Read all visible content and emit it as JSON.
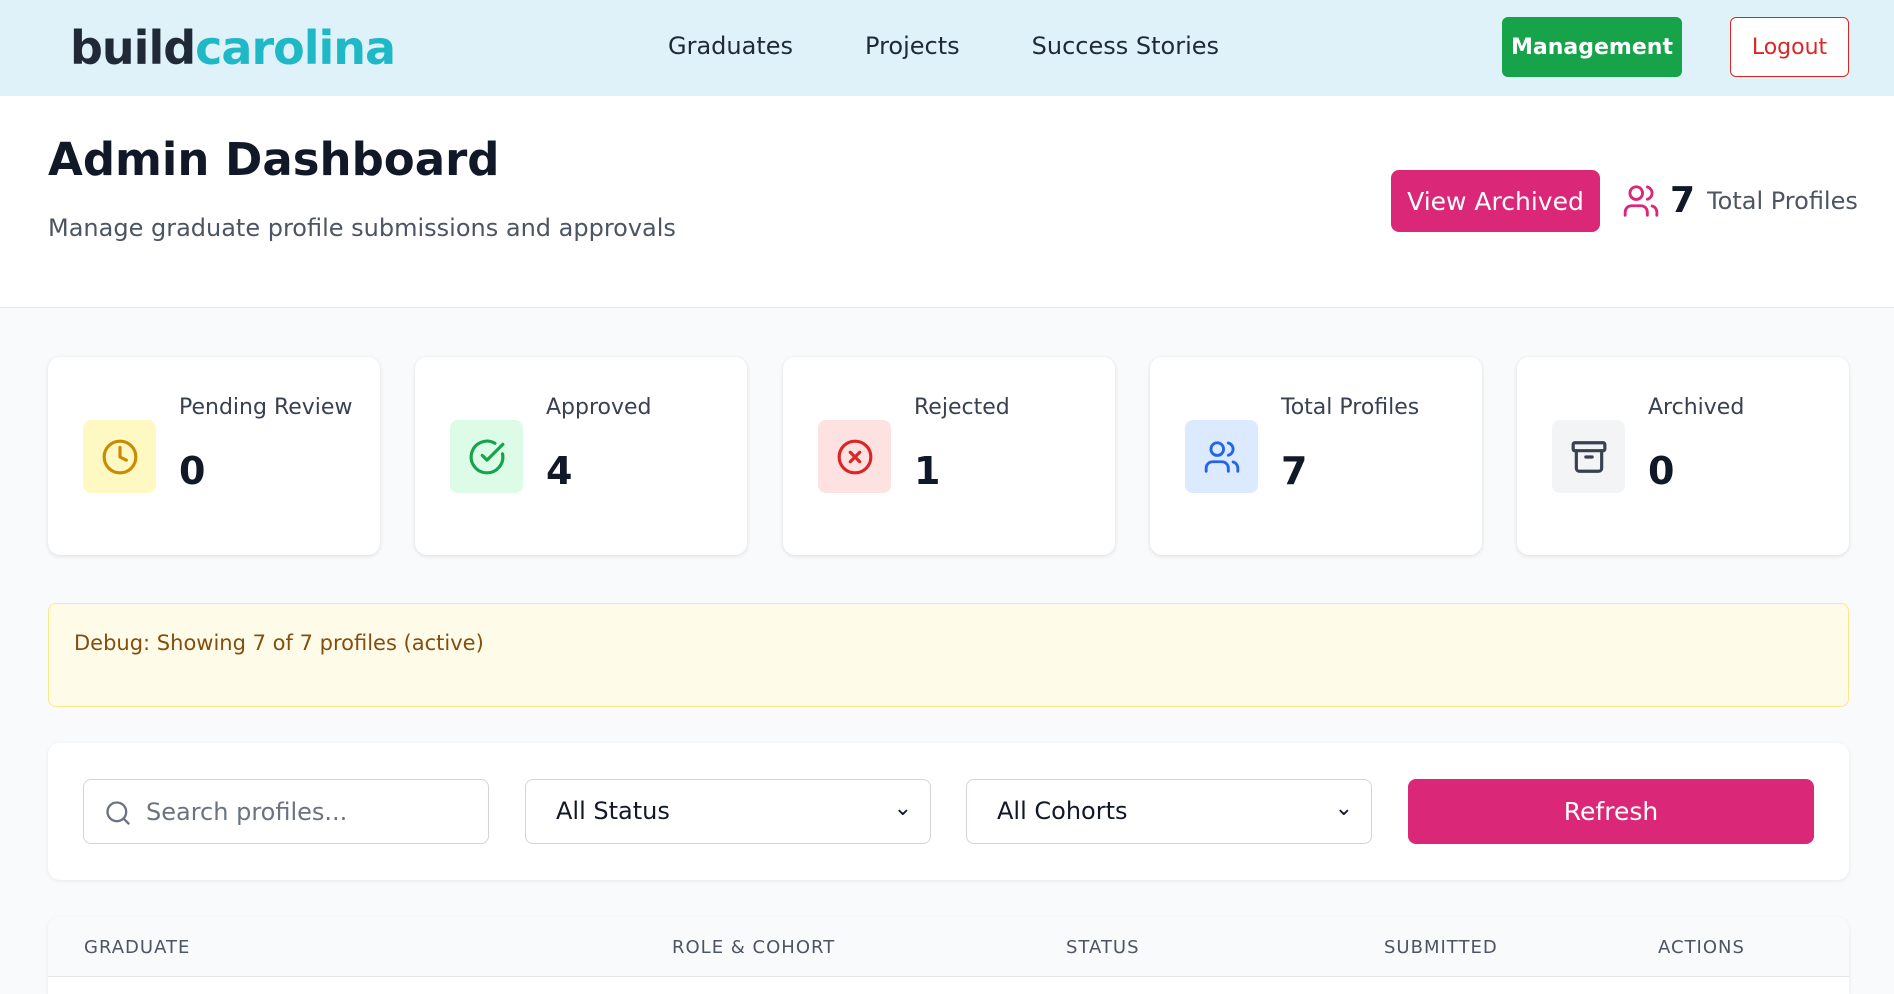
{
  "nav": {
    "logo_part1": "build",
    "logo_part2": "carolina",
    "links": [
      "Graduates",
      "Projects",
      "Success Stories"
    ],
    "management_label": "Management",
    "logout_label": "Logout"
  },
  "header": {
    "title": "Admin Dashboard",
    "subtitle": "Manage graduate profile submissions and approvals",
    "view_archived_label": "View Archived",
    "total_count": "7",
    "total_label": "Total Profiles"
  },
  "stats": [
    {
      "label": "Pending Review",
      "value": "0",
      "icon": "clock-icon",
      "icon_color": "#ca8a04",
      "bg": "#fef9c3"
    },
    {
      "label": "Approved",
      "value": "4",
      "icon": "check-circle-icon",
      "icon_color": "#16a34a",
      "bg": "#dcfce7"
    },
    {
      "label": "Rejected",
      "value": "1",
      "icon": "x-circle-icon",
      "icon_color": "#dc2626",
      "bg": "#fee2e2"
    },
    {
      "label": "Total Profiles",
      "value": "7",
      "icon": "users-icon",
      "icon_color": "#2563eb",
      "bg": "#dbeafe"
    },
    {
      "label": "Archived",
      "value": "0",
      "icon": "archive-icon",
      "icon_color": "#374151",
      "bg": "#f3f4f6"
    }
  ],
  "debug": {
    "text": "Debug: Showing 7 of 7 profiles (active)"
  },
  "filters": {
    "search_placeholder": "Search profiles...",
    "status_value": "All Status",
    "cohort_value": "All Cohorts",
    "refresh_label": "Refresh"
  },
  "table": {
    "columns": [
      "GRADUATE",
      "ROLE & COHORT",
      "STATUS",
      "SUBMITTED",
      "ACTIONS"
    ]
  },
  "colors": {
    "primary_pink": "#db2777",
    "management_green": "#16a34a",
    "logout_red": "#dc2626",
    "navbar_bg": "#e0f2f9"
  }
}
